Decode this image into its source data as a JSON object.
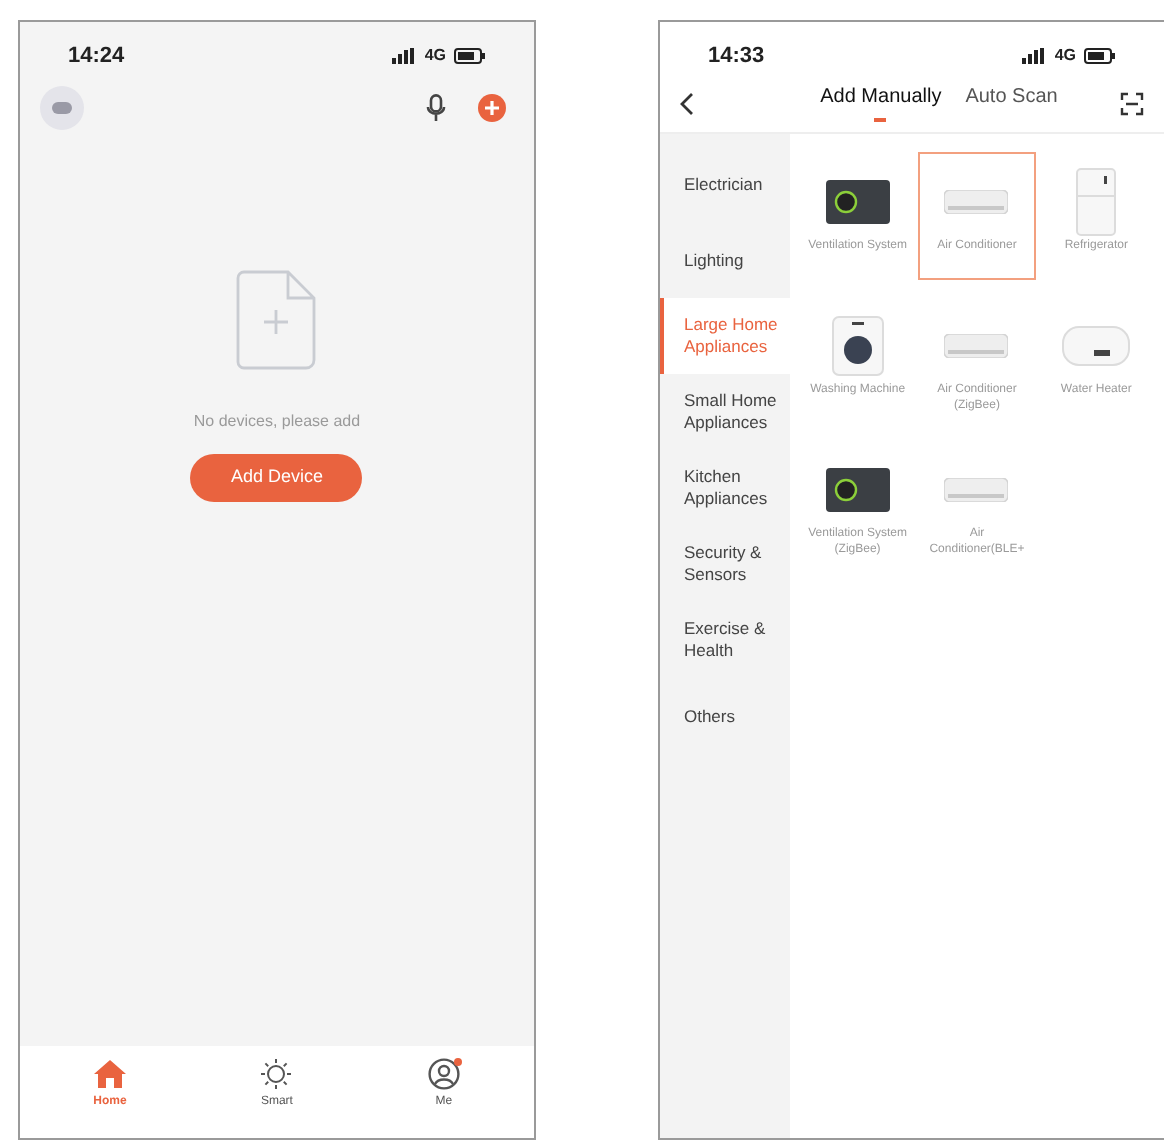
{
  "home_screen": {
    "status_bar": {
      "time": "14:24",
      "network": "4G"
    },
    "empty_state": {
      "message": "No devices, please add",
      "button": "Add Device"
    },
    "tab_bar": [
      {
        "label": "Home",
        "kind": "home",
        "selected": true,
        "badge": false
      },
      {
        "label": "Smart",
        "kind": "smart",
        "selected": false,
        "badge": false
      },
      {
        "label": "Me",
        "kind": "me",
        "selected": false,
        "badge": true
      }
    ]
  },
  "add_device_screen": {
    "status_bar": {
      "time": "14:33",
      "network": "4G"
    },
    "tabs": [
      {
        "label": "Add Manually",
        "selected": true
      },
      {
        "label": "Auto Scan",
        "selected": false
      }
    ],
    "categories": [
      {
        "label": "Electrician",
        "selected": false
      },
      {
        "label": "Lighting",
        "selected": false
      },
      {
        "label": "Large Home Appliances",
        "selected": true
      },
      {
        "label": "Small Home Appliances",
        "selected": false
      },
      {
        "label": "Kitchen Appliances",
        "selected": false
      },
      {
        "label": "Security & Sensors",
        "selected": false
      },
      {
        "label": "Exercise & Health",
        "selected": false
      },
      {
        "label": "Others",
        "selected": false
      }
    ],
    "devices": [
      {
        "label": "Ventilation System",
        "kind": "ventilation",
        "selected": false
      },
      {
        "label": "Air Conditioner",
        "kind": "ac",
        "selected": true
      },
      {
        "label": "Refrigerator",
        "kind": "fridge",
        "selected": false
      },
      {
        "label": "Washing Machine",
        "kind": "washer",
        "selected": false
      },
      {
        "label": "Air Conditioner (ZigBee)",
        "kind": "ac",
        "selected": false
      },
      {
        "label": "Water Heater",
        "kind": "heater",
        "selected": false
      },
      {
        "label": "Ventilation System (ZigBee)",
        "kind": "ventilation",
        "selected": false
      },
      {
        "label": "Air Conditioner(BLE+",
        "kind": "ac",
        "selected": false
      }
    ]
  }
}
